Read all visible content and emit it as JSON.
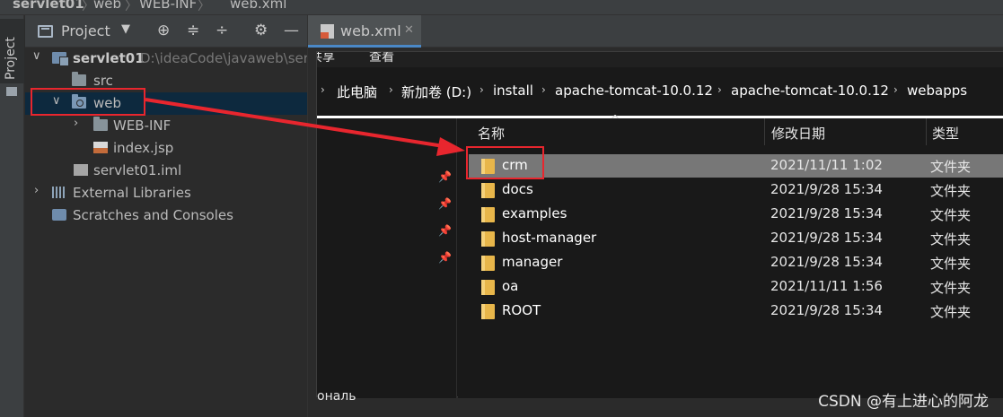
{
  "breadcrumb": {
    "items": [
      "servlet01",
      "web",
      "WEB-INF",
      "web.xml"
    ]
  },
  "tool_strip": {
    "project_tab": "Project"
  },
  "project_header": {
    "title": "Project",
    "icons": [
      "project-icon",
      "caret-down-icon",
      "target-icon",
      "expand-all-icon",
      "collapse-all-icon",
      "gear-icon",
      "minimize-icon"
    ]
  },
  "tree": {
    "module_name": "servlet01",
    "module_path": "D:\\ideaCode\\javaweb\\ser",
    "src": "src",
    "web": "web",
    "web_inf": "WEB-INF",
    "index": "index.jsp",
    "iml": "servlet01.iml",
    "external_libraries": "External Libraries",
    "scratches": "Scratches and Consoles"
  },
  "editor": {
    "tab_label": "web.xml"
  },
  "explorer": {
    "menu": [
      "共享",
      "查看"
    ],
    "address": [
      "此电脑",
      "新加卷 (D:)",
      "install",
      "apache-tomcat-10.0.12",
      "apache-tomcat-10.0.12",
      "webapps"
    ],
    "columns": {
      "name": "名称",
      "date": "修改日期",
      "type": "类型"
    },
    "files": [
      {
        "name": "crm",
        "date": "2021/11/11 1:02",
        "type": "文件夹"
      },
      {
        "name": "docs",
        "date": "2021/9/28 15:34",
        "type": "文件夹"
      },
      {
        "name": "examples",
        "date": "2021/9/28 15:34",
        "type": "文件夹"
      },
      {
        "name": "host-manager",
        "date": "2021/9/28 15:34",
        "type": "文件夹"
      },
      {
        "name": "manager",
        "date": "2021/9/28 15:34",
        "type": "文件夹"
      },
      {
        "name": "oa",
        "date": "2021/11/11 1:56",
        "type": "文件夹"
      },
      {
        "name": "ROOT",
        "date": "2021/9/28 15:34",
        "type": "文件夹"
      }
    ],
    "left_edge_text": "ональ"
  },
  "watermark": "CSDN @有上进心的阿龙",
  "colors": {
    "annotation_red": "#e8262e",
    "selection_blue": "#0d293e",
    "tab_underline": "#4a88c7",
    "folder_yellow": "#e8b64a"
  }
}
